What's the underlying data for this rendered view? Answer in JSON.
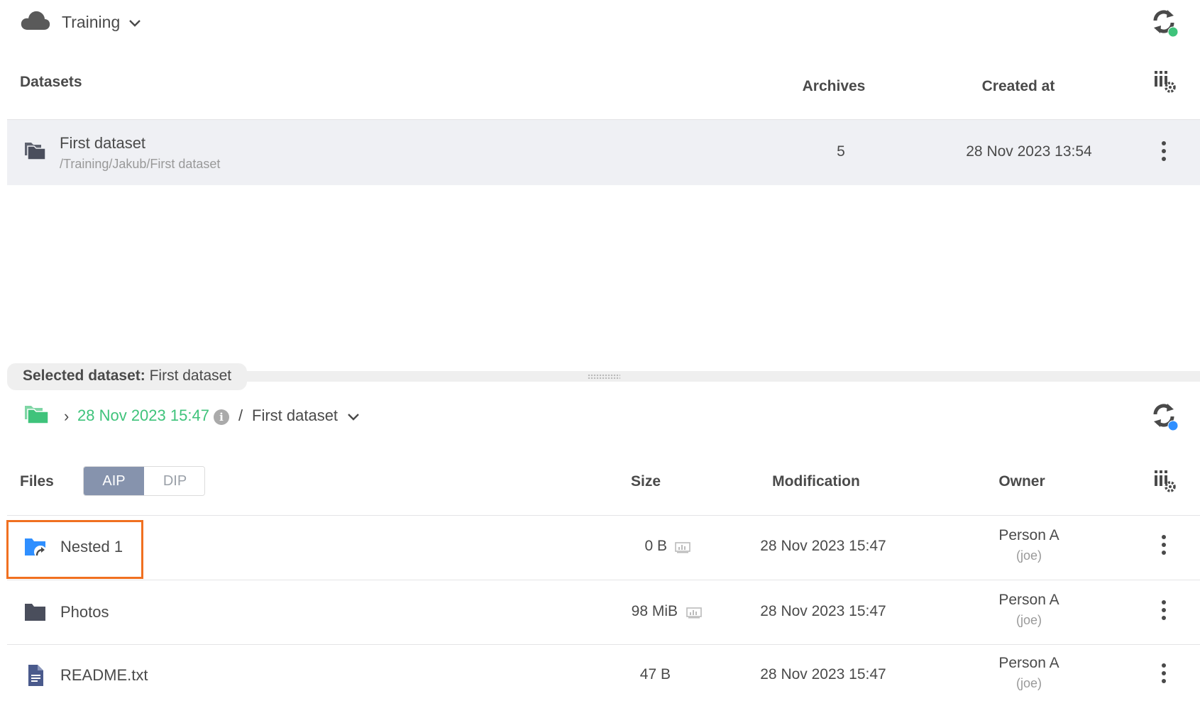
{
  "header": {
    "space_name": "Training",
    "status_dot_color": "#3fc37b",
    "cloud_icon": "cloud-icon",
    "sync_icon": "sync-icon"
  },
  "datasets": {
    "columns": {
      "name": "Datasets",
      "archives": "Archives",
      "created": "Created at"
    },
    "rows": [
      {
        "name": "First dataset",
        "path": "/Training/Jakub/First dataset",
        "archives": "5",
        "created": "28 Nov 2023 13:54"
      }
    ]
  },
  "splitter": {
    "label": "Selected dataset:",
    "value": "First dataset"
  },
  "browser": {
    "breadcrumb": {
      "archive_date": "28 Nov 2023 15:47",
      "separator": "/",
      "dataset": "First dataset"
    },
    "status_dot_color": "#2f8fff",
    "columns": {
      "files": "Files",
      "size": "Size",
      "modification": "Modification",
      "owner": "Owner"
    },
    "toggle": {
      "aip": "AIP",
      "dip": "DIP",
      "selected": "AIP"
    },
    "files": [
      {
        "name": "Nested 1",
        "icon": "folder-symlink-icon",
        "size": "0 B",
        "modification": "28 Nov 2023 15:47",
        "owner": "Person A",
        "owner_login": "(joe)"
      },
      {
        "name": "Photos",
        "icon": "folder-icon",
        "size": "98 MiB",
        "modification": "28 Nov 2023 15:47",
        "owner": "Person A",
        "owner_login": "(joe)"
      },
      {
        "name": "README.txt",
        "icon": "file-icon",
        "size": "47 B",
        "modification": "28 Nov 2023 15:47",
        "owner": "Person A",
        "owner_login": "(joe)"
      }
    ]
  }
}
